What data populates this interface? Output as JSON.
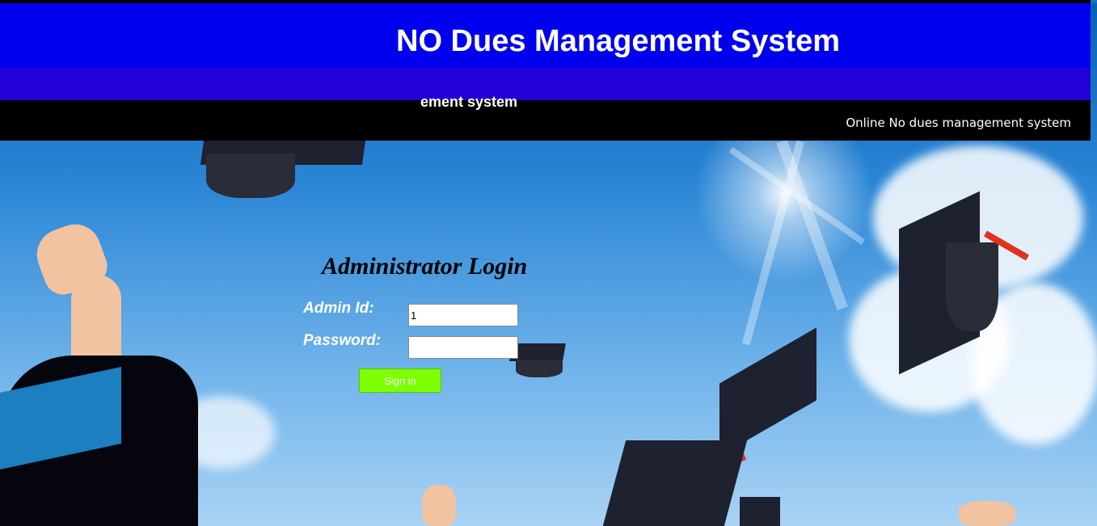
{
  "header": {
    "title": "NO Dues Management System",
    "marquee": "ement system",
    "tagline": "Online No dues management system"
  },
  "login": {
    "heading": "Administrator Login",
    "admin_id_label": "Admin Id:",
    "admin_id_value": "1",
    "password_label": "Password:",
    "password_value": "",
    "submit_label": "Sign in"
  },
  "colors": {
    "title_bar": "#0000ee",
    "sub_bar": "#2400d8",
    "button": "#7cff00"
  }
}
